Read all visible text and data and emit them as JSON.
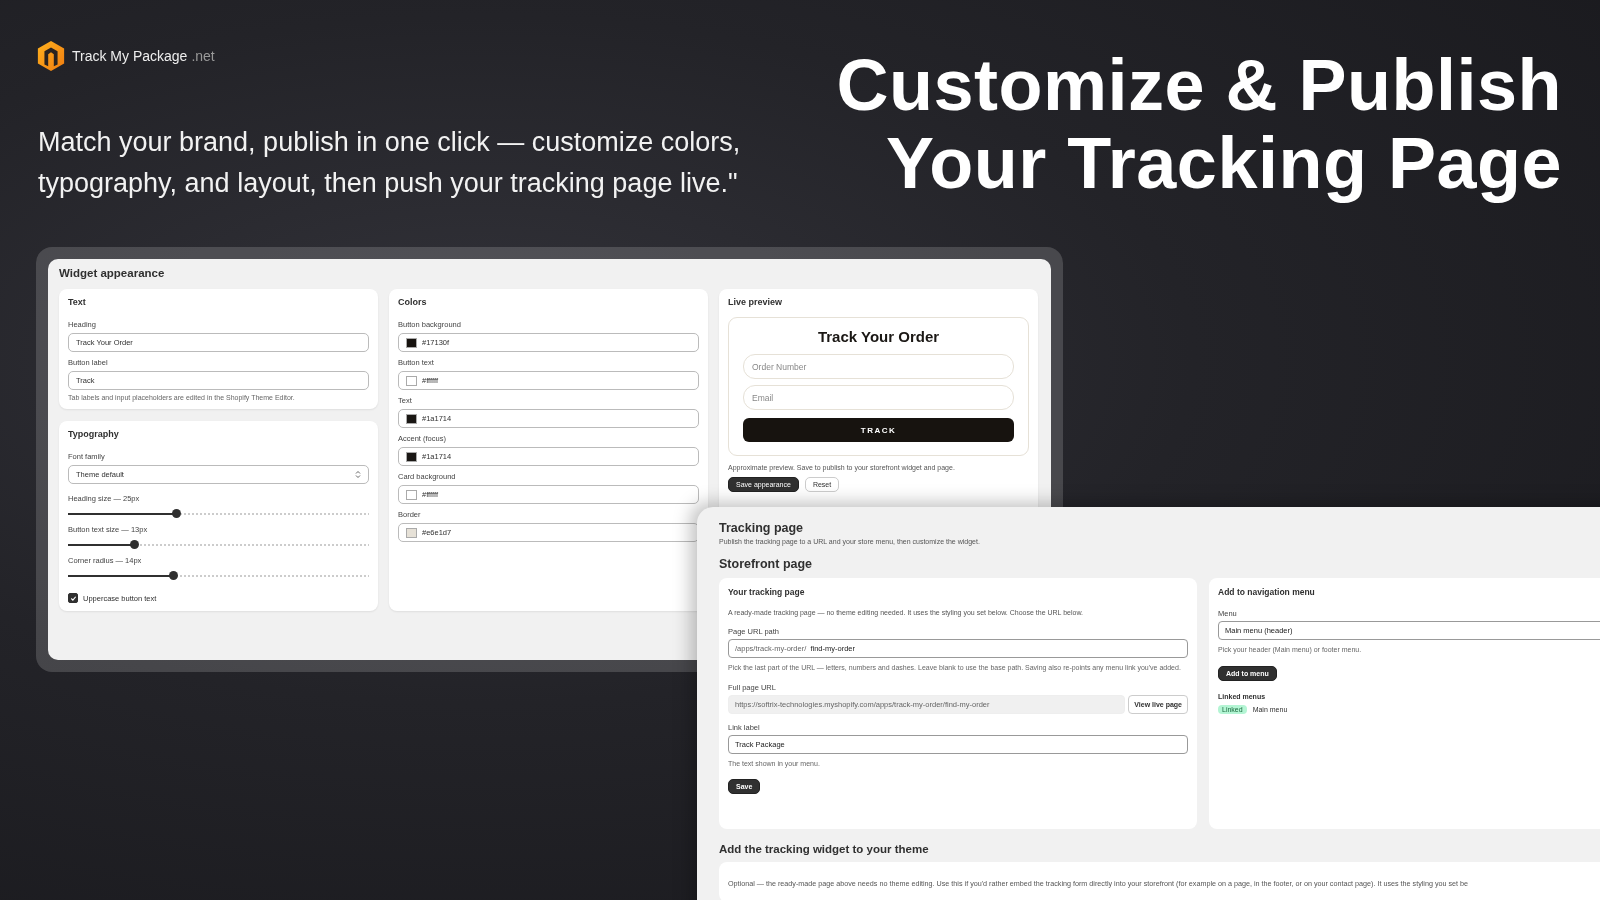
{
  "brand": {
    "name": "Track My Package",
    "suffix": ".net"
  },
  "headline": [
    "Customize & Publish",
    "Your Tracking Page"
  ],
  "subtitle_lines": [
    "Match your brand, publish in one click — customize colors,",
    "typography, and layout, then push your tracking page live.\""
  ],
  "widget": {
    "title": "Widget appearance",
    "text_card": {
      "title": "Text",
      "fields": [
        {
          "label": "Heading",
          "value": "Track Your Order"
        },
        {
          "label": "Button label",
          "value": "Track"
        }
      ],
      "hint": "Tab labels and input placeholders are edited in the Shopify Theme Editor."
    },
    "typography": {
      "title": "Typography",
      "font_family": {
        "label": "Font family",
        "value": "Theme default"
      },
      "sliders": [
        {
          "label": "Heading size — 25px",
          "level": 0.36
        },
        {
          "label": "Button text size — 13px",
          "level": 0.22
        },
        {
          "label": "Corner radius — 14px",
          "level": 0.35
        }
      ],
      "checkbox": {
        "label": "Uppercase button text",
        "checked": true
      }
    },
    "colors": {
      "title": "Colors",
      "items": [
        {
          "label": "Button background",
          "value": "#17130f",
          "color": "#17130f"
        },
        {
          "label": "Button text",
          "value": "#ffffff",
          "color": "#ffffff"
        },
        {
          "label": "Text",
          "value": "#1a1714",
          "color": "#1a1714"
        },
        {
          "label": "Accent (focus)",
          "value": "#1a1714",
          "color": "#1a1714"
        },
        {
          "label": "Card background",
          "value": "#ffffff",
          "color": "#ffffff"
        },
        {
          "label": "Border",
          "value": "#e6e1d7",
          "color": "#e6e1d7"
        }
      ]
    },
    "preview": {
      "title": "Live preview",
      "heading": "Track Your Order",
      "fields": [
        {
          "placeholder": "Order Number"
        },
        {
          "placeholder": "Email"
        }
      ],
      "button": "TRACK",
      "note": "Approximate preview. Save to publish to your storefront widget and page.",
      "buttons": [
        {
          "label": "Save appearance",
          "kind": "primary"
        },
        {
          "label": "Reset",
          "kind": "secondary"
        }
      ]
    }
  },
  "tracking": {
    "title": "Tracking page",
    "subtitle": "Publish the tracking page to a URL and your store menu, then customize the widget.",
    "section_title": "Storefront page",
    "page_card": {
      "title": "Your tracking page",
      "description": "A ready-made tracking page — no theme editing needed. It uses the styling you set below. Choose the URL below.",
      "url_path": {
        "label": "Page URL path",
        "prefix": "/apps/track-my-order/",
        "value": "find-my-order"
      },
      "url_hint": "Pick the last part of the URL — letters, numbers and dashes. Leave blank to use the base path. Saving also re-points any menu link you've added.",
      "full_url": {
        "label": "Full page URL",
        "value": "https://softrix-technologies.myshopify.com/apps/track-my-order/find-my-order",
        "button": "View live page"
      },
      "link_label": {
        "label": "Link label",
        "value": "Track Package",
        "hint": "The text shown in your menu."
      },
      "save": "Save"
    },
    "nav_card": {
      "title": "Add to navigation menu",
      "menu": {
        "label": "Menu",
        "value": "Main menu (header)",
        "hint": "Pick your header (Main menu) or footer menu."
      },
      "button": "Add to menu",
      "linked": {
        "title": "Linked menus",
        "items": [
          {
            "badge": "Linked",
            "name": "Main menu"
          }
        ]
      }
    },
    "widget_section": {
      "title": "Add the tracking widget to your theme",
      "text": "Optional — the ready-made page above needs no theme editing. Use this if you'd rather embed the tracking form directly into your storefront (for example on a page, in the footer, or on your contact page). It uses the styling you set be"
    }
  }
}
